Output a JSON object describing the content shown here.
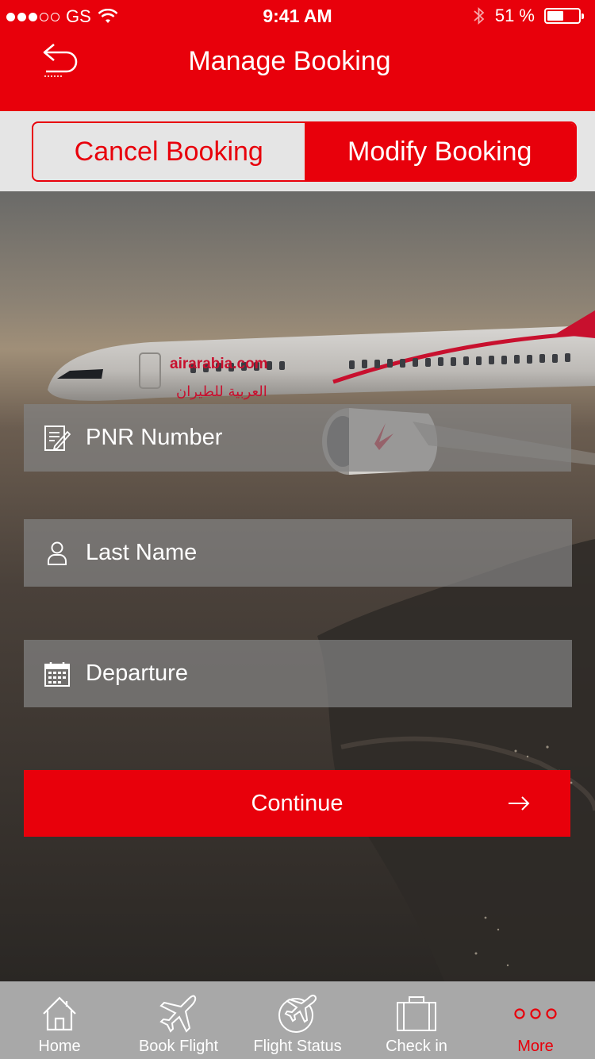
{
  "status_bar": {
    "carrier": "GS",
    "time": "9:41 AM",
    "battery_percent": "51 %",
    "battery_level": 0.51
  },
  "header": {
    "title": "Manage Booking",
    "back_icon": "back-arrow-icon"
  },
  "segments": {
    "cancel_label": "Cancel Booking",
    "modify_label": "Modify Booking",
    "selected": "Modify Booking"
  },
  "background": {
    "brand_text": "airarabia.com",
    "arabic_text": "العربية للطيران"
  },
  "form": {
    "pnr_placeholder": "PNR Number",
    "last_name_placeholder": "Last Name",
    "departure_placeholder": "Departure",
    "continue_label": "Continue"
  },
  "tabs": [
    {
      "label": "Home",
      "icon": "home-icon"
    },
    {
      "label": "Book Flight",
      "icon": "airplane-icon"
    },
    {
      "label": "Flight Status",
      "icon": "flight-status-icon"
    },
    {
      "label": "Check in",
      "icon": "suitcase-icon"
    },
    {
      "label": "More",
      "icon": "more-dots-icon"
    }
  ],
  "colors": {
    "brand_red": "#e8000b",
    "tabbar_gray": "#a8a8a8",
    "segment_bg": "#e5e5e5"
  }
}
